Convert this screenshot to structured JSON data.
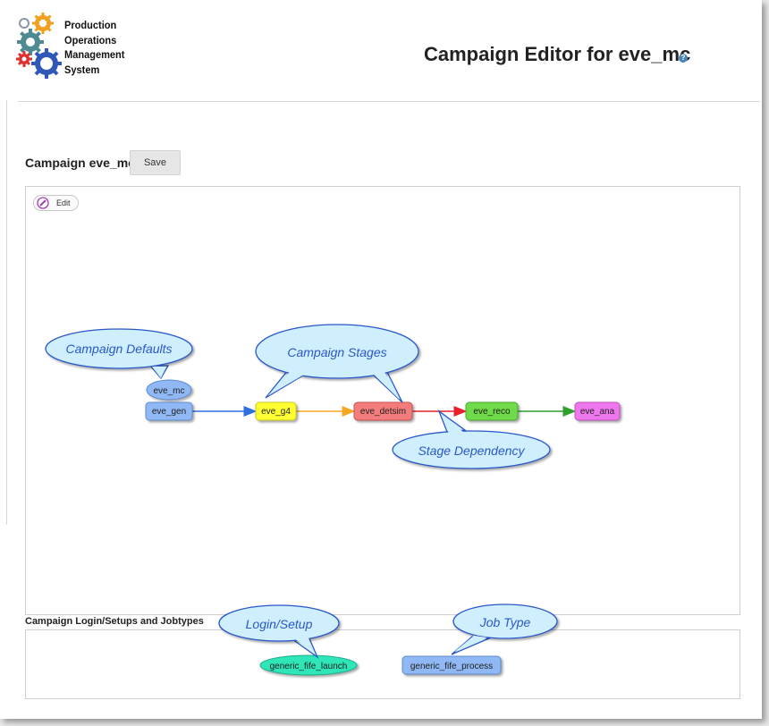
{
  "header": {
    "logo_lines": [
      "Production",
      "Operations",
      "Management",
      "System"
    ],
    "title": "Campaign Editor for eve_mc",
    "help_icon": "question-circle-icon"
  },
  "campaign": {
    "label": "Campaign eve_mc",
    "save_label": "Save"
  },
  "graph": {
    "edit_label": "Edit",
    "defaults_node": "eve_mc",
    "stages": [
      {
        "name": "eve_gen",
        "color": "#8fb8f4"
      },
      {
        "name": "eve_g4",
        "color": "#ffff33"
      },
      {
        "name": "eve_detsim",
        "color": "#f47b7b"
      },
      {
        "name": "eve_reco",
        "color": "#6fdb4a"
      },
      {
        "name": "eve_ana",
        "color": "#ee77ee"
      }
    ],
    "edge_colors": [
      "#2f6fe0",
      "#f5a623",
      "#e8202a",
      "#2e9e2e"
    ],
    "callouts": {
      "defaults": "Campaign Defaults",
      "stages": "Campaign Stages",
      "dependency": "Stage Dependency",
      "login": "Login/Setup",
      "jobtype": "Job Type"
    }
  },
  "login_section": {
    "label": "Campaign Login/Setups and Jobtypes",
    "login_node": "generic_fife_launch",
    "job_node": "generic_fife_process"
  }
}
